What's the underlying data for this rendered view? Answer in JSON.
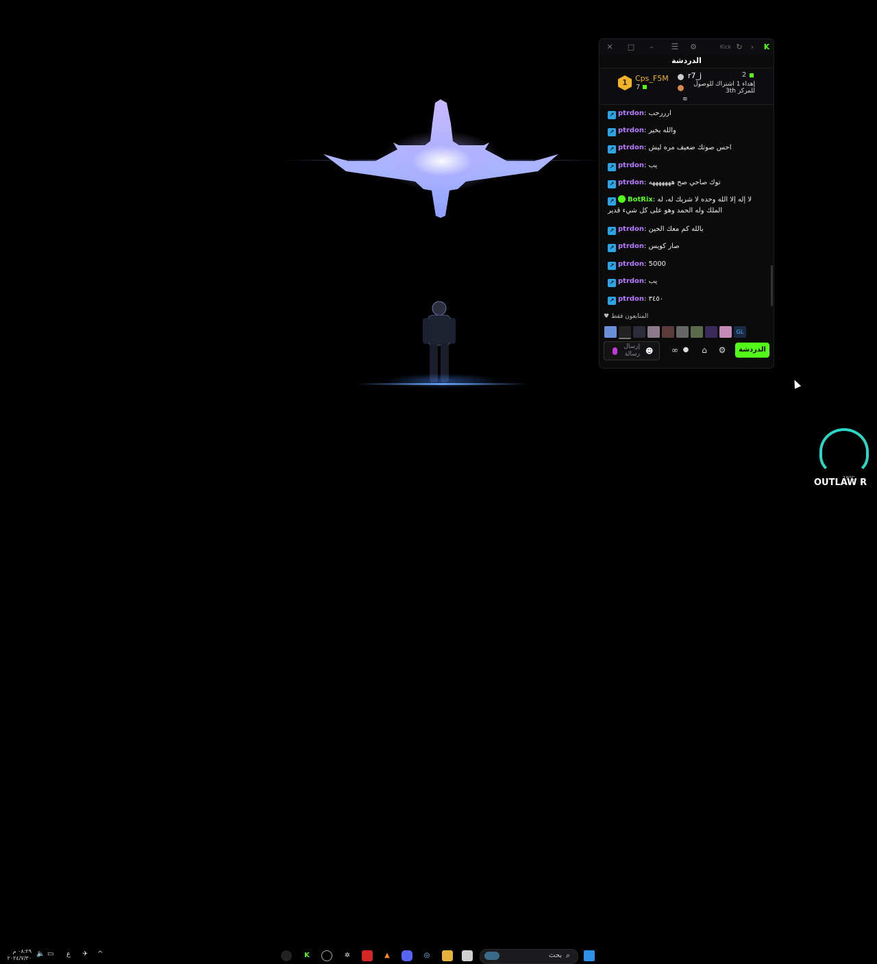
{
  "window": {
    "title_right": "Kick",
    "chat_title": "الدردشة"
  },
  "leaderboard": {
    "first": {
      "rank": "1",
      "name": "Cps_F5M",
      "count": "7"
    },
    "second": {
      "name": "r7_j",
      "count": "2",
      "desc": "إهداء 1 اشتراك للوصول للمركز 3th"
    }
  },
  "messages": [
    {
      "user": "ptrdon",
      "text": "ارررحب"
    },
    {
      "user": "ptrdon",
      "text": "والله بخير"
    },
    {
      "user": "ptrdon",
      "text": "احس صوتك ضعيف مره ليش"
    },
    {
      "user": "ptrdon",
      "text": "يب"
    },
    {
      "user": "ptrdon",
      "text": "توك صاحي صح هههههههه"
    },
    {
      "user": "BotRix",
      "text": "لا إله إلا الله وحده لا شريك له، له الملك وله الحمد وهو على كل شيء قدير",
      "bot": true
    },
    {
      "user": "ptrdon",
      "text": "بالله كم معك الحين"
    },
    {
      "user": "ptrdon",
      "text": "صار كويس"
    },
    {
      "user": "ptrdon",
      "text": "5000"
    },
    {
      "user": "ptrdon",
      "text": "يب"
    },
    {
      "user": "ptrdon",
      "text": "٣٤٥٠"
    }
  ],
  "followers_label": "المتابعون فقط",
  "input": {
    "placeholder": "إرسال رسالة"
  },
  "chat_button": "الدردشة",
  "taskbar": {
    "search_label": "بحث",
    "time": "٠٨:٢٩ م",
    "date": "٢٠٢٤/٧/٣٠",
    "lang": "ع"
  },
  "watermark": {
    "text": "OUTLAW R",
    "temp": "19°C"
  },
  "colors": {
    "accent": "#53fc18",
    "username": "#b67cff",
    "badge": "#2aa6e6"
  }
}
